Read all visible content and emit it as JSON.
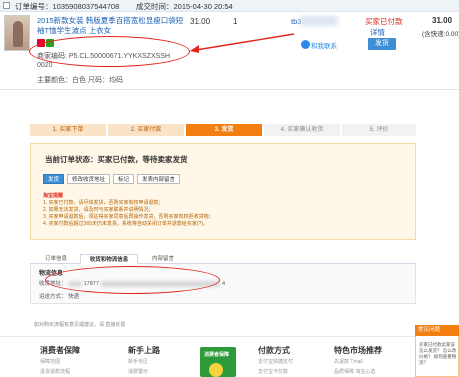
{
  "order": {
    "order_number": "订单编号：1035908037544708",
    "deal_time": "成交时间：2015-04-30 20:54",
    "item_title": "2015新款女装 韩版夏季百搭宽松显瘦口袋短袖T恤学生波点 上衣女",
    "item_code_line1": "商家编码: P5.CL.50000671.YYKXSZXSSH",
    "item_code_line2": "0020",
    "item_attrs": "主要颜色：白色   尺码：均码",
    "price": "31.00",
    "quantity": "1",
    "seller_id": "tb3",
    "wangwang_label": "和我联系",
    "status_paid": "买家已付款",
    "status_detail": "详情",
    "ship_button": "发货",
    "total": "31.00",
    "total_note": "(含快递:0.00)"
  },
  "steps": [
    {
      "label": "1. 买家下单"
    },
    {
      "label": "2. 买家付款"
    },
    {
      "label": "3. 发货"
    },
    {
      "label": "4. 买家确认收货"
    },
    {
      "label": "5. 评价"
    }
  ],
  "status_box": {
    "title": "当前订单状态：买家已付款，等待卖家发货",
    "buttons": [
      "发货",
      "修改收货地址",
      "标记",
      "发表内部留言"
    ],
    "tips_title": "淘宝提醒",
    "tips": [
      "1. 买家已付款，请尽快发货，否则买家有权申请退款；",
      "2. 如果无法发货，请及时与买家联系并说明情况；",
      "3. 买家申请退款后，须征得买家同意后再操作发货，否则买家有权拒收货物；",
      "4. 买家付款后超过365天仍未发货，系统将自动关闭订单并退款给买家(?)。"
    ]
  },
  "tabs": [
    "订单信息",
    "收货和物流信息",
    "内部留言"
  ],
  "logistics": {
    "title": "物流信息",
    "address_label": "收货地址：",
    "address_fragment": "17877",
    "address_tail": "4",
    "method_label": "运送方式：",
    "method_value": "快递"
  },
  "note": "如对购买流程有意见或建议，请 直接反馈",
  "footer": [
    {
      "heading": "消费者保障",
      "links": [
        "保障范围",
        "退货退款流程"
      ]
    },
    {
      "heading": "新手上路",
      "links": [
        "新手专区",
        "消费警示"
      ]
    },
    {
      "heading": "付款方式",
      "links": [
        "支付宝快捷支付",
        "支付宝卡付款"
      ]
    },
    {
      "heading": "特色市场推荐",
      "links": [
        "先退款  Tmall",
        "品质保障 淘宝心选"
      ]
    }
  ],
  "promo": {
    "text": "消费者保障"
  },
  "side_panel": {
    "title": "常见问题",
    "text": "买家已付款卖家该怎么发货？ 怎么改价格？ 如何查看物流？"
  }
}
